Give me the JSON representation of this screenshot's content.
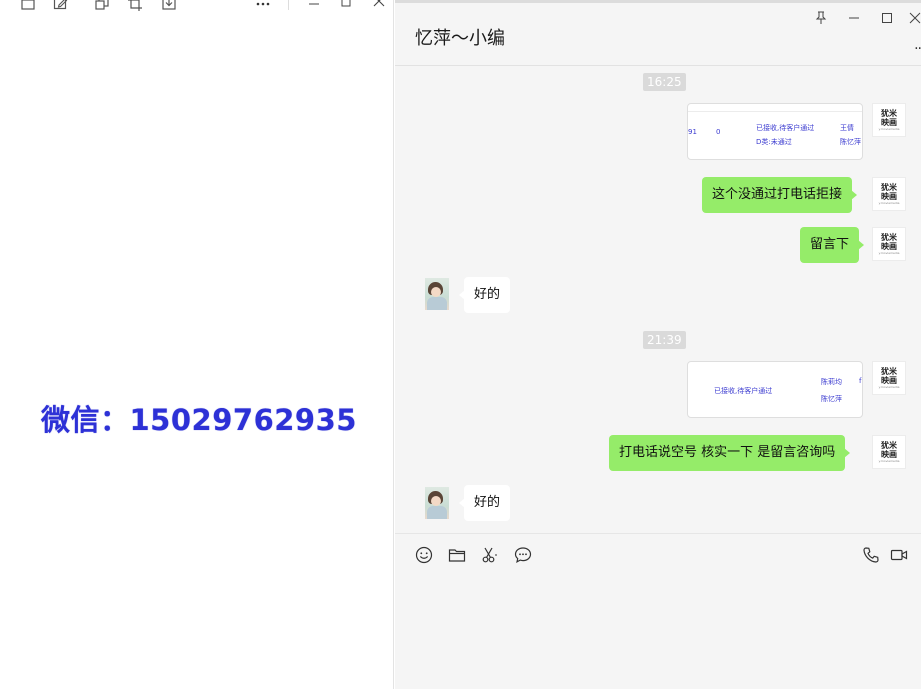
{
  "viewer": {
    "toolbar_icons": [
      "frame-icon",
      "edit-icon",
      "copy-icon",
      "crop-icon",
      "download-icon",
      "more-icon",
      "minimize-icon",
      "maximize-icon",
      "close-icon"
    ],
    "image_text": "微信：15029762935"
  },
  "chat": {
    "title": "忆萍～小编",
    "window_icons": [
      "pin-icon",
      "minimize-icon",
      "maximize-icon",
      "close-icon"
    ],
    "more_label": "··",
    "messages": [
      {
        "type": "time",
        "text": "16:25"
      },
      {
        "type": "image",
        "from": "me",
        "cells": [
          "已接收,待客户通过",
          "王倩",
          "D类:未通过",
          "陈忆萍",
          "91",
          "0"
        ]
      },
      {
        "type": "text",
        "from": "me",
        "text": "这个没通过打电话拒接"
      },
      {
        "type": "text",
        "from": "me",
        "text": "留言下"
      },
      {
        "type": "text",
        "from": "other",
        "text": "好的"
      },
      {
        "type": "time",
        "text": "21:39"
      },
      {
        "type": "image",
        "from": "me",
        "cells": [
          "已接收,待客户通过",
          "陈莉均",
          "陈忆萍",
          "f"
        ]
      },
      {
        "type": "text",
        "from": "me",
        "text": "打电话说空号 核实一下 是留言咨询吗"
      },
      {
        "type": "text",
        "from": "other",
        "text": "好的"
      }
    ],
    "brand_avatar": {
      "line1": "犹米",
      "line2": "映画",
      "tagline": "y.moviemedia"
    },
    "toolbar_icons": [
      "emoji-icon",
      "folder-icon",
      "scissors-icon",
      "chat-history-icon",
      "phone-icon",
      "video-call-icon"
    ]
  },
  "colors": {
    "accent_green": "#95ec69",
    "image_text_blue": "#2d31d6"
  }
}
